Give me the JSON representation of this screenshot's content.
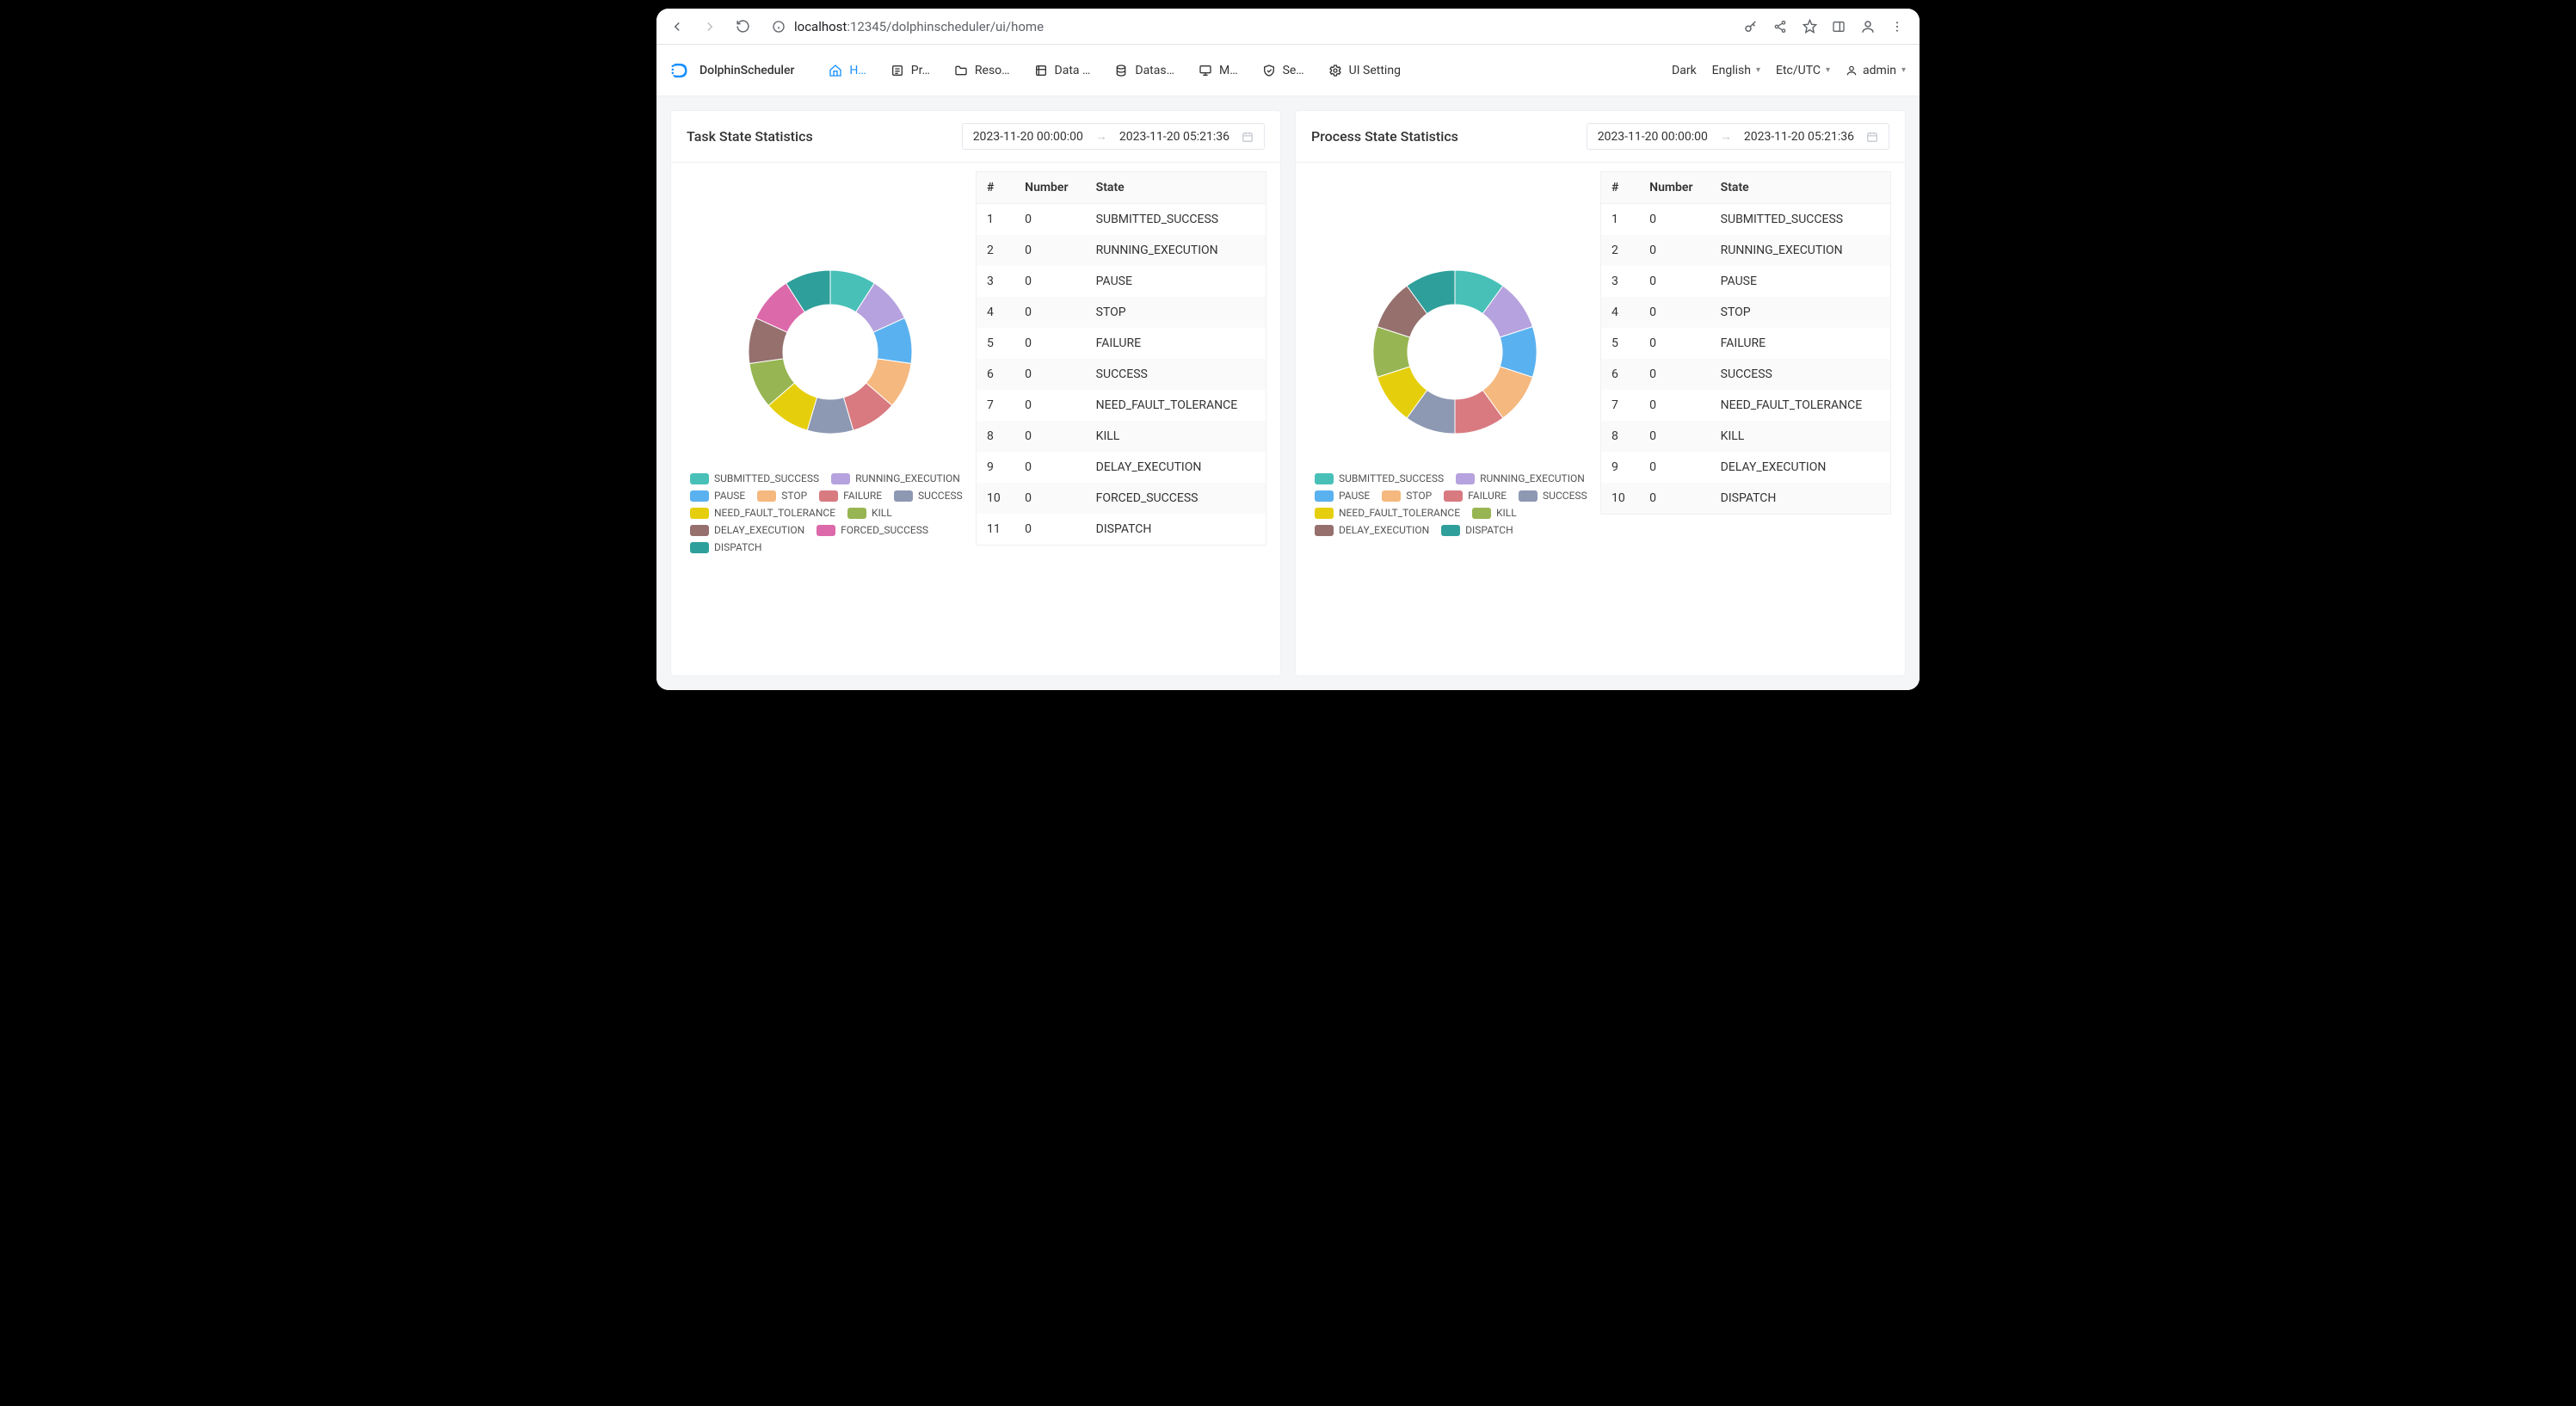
{
  "browser": {
    "url_host": "localhost",
    "url_port": ":12345",
    "url_path": "/dolphinscheduler/ui/home"
  },
  "header": {
    "product": "DolphinScheduler",
    "nav": [
      {
        "label": "H…",
        "icon": "home-icon",
        "active": true
      },
      {
        "label": "Pr…",
        "icon": "project-icon",
        "active": false
      },
      {
        "label": "Reso…",
        "icon": "folder-icon",
        "active": false
      },
      {
        "label": "Data …",
        "icon": "datacenter-icon",
        "active": false
      },
      {
        "label": "Datas…",
        "icon": "datasource-icon",
        "active": false
      },
      {
        "label": "M…",
        "icon": "monitor-icon",
        "active": false
      },
      {
        "label": "Se…",
        "icon": "security-icon",
        "active": false
      },
      {
        "label": "UI Setting",
        "icon": "gear-icon",
        "active": false
      }
    ],
    "theme": "Dark",
    "language": "English",
    "timezone": "Etc/UTC",
    "user": "admin"
  },
  "colors": {
    "SUBMITTED_SUCCESS": "#48c0b8",
    "RUNNING_EXECUTION": "#b6a2de",
    "PAUSE": "#5ab1ef",
    "STOP": "#f5b87f",
    "FAILURE": "#d87a80",
    "SUCCESS": "#8d98b3",
    "NEED_FAULT_TOLERANCE": "#e5cf0d",
    "KILL": "#97b552",
    "DELAY_EXECUTION": "#95706d",
    "FORCED_SUCCESS": "#dc69aa",
    "DISPATCH": "#2f9f9b"
  },
  "cards": [
    {
      "title": "Task State Statistics",
      "range_from": "2023-11-20 00:00:00",
      "range_to": "2023-11-20 05:21:36",
      "columns": [
        "#",
        "Number",
        "State"
      ],
      "rows": [
        {
          "idx": 1,
          "num": 0,
          "state": "SUBMITTED_SUCCESS"
        },
        {
          "idx": 2,
          "num": 0,
          "state": "RUNNING_EXECUTION"
        },
        {
          "idx": 3,
          "num": 0,
          "state": "PAUSE"
        },
        {
          "idx": 4,
          "num": 0,
          "state": "STOP"
        },
        {
          "idx": 5,
          "num": 0,
          "state": "FAILURE"
        },
        {
          "idx": 6,
          "num": 0,
          "state": "SUCCESS"
        },
        {
          "idx": 7,
          "num": 0,
          "state": "NEED_FAULT_TOLERANCE"
        },
        {
          "idx": 8,
          "num": 0,
          "state": "KILL"
        },
        {
          "idx": 9,
          "num": 0,
          "state": "DELAY_EXECUTION"
        },
        {
          "idx": 10,
          "num": 0,
          "state": "FORCED_SUCCESS"
        },
        {
          "idx": 11,
          "num": 0,
          "state": "DISPATCH"
        }
      ],
      "legend": [
        "SUBMITTED_SUCCESS",
        "RUNNING_EXECUTION",
        "PAUSE",
        "STOP",
        "FAILURE",
        "SUCCESS",
        "NEED_FAULT_TOLERANCE",
        "KILL",
        "DELAY_EXECUTION",
        "FORCED_SUCCESS",
        "DISPATCH"
      ]
    },
    {
      "title": "Process State Statistics",
      "range_from": "2023-11-20 00:00:00",
      "range_to": "2023-11-20 05:21:36",
      "columns": [
        "#",
        "Number",
        "State"
      ],
      "rows": [
        {
          "idx": 1,
          "num": 0,
          "state": "SUBMITTED_SUCCESS"
        },
        {
          "idx": 2,
          "num": 0,
          "state": "RUNNING_EXECUTION"
        },
        {
          "idx": 3,
          "num": 0,
          "state": "PAUSE"
        },
        {
          "idx": 4,
          "num": 0,
          "state": "STOP"
        },
        {
          "idx": 5,
          "num": 0,
          "state": "FAILURE"
        },
        {
          "idx": 6,
          "num": 0,
          "state": "SUCCESS"
        },
        {
          "idx": 7,
          "num": 0,
          "state": "NEED_FAULT_TOLERANCE"
        },
        {
          "idx": 8,
          "num": 0,
          "state": "KILL"
        },
        {
          "idx": 9,
          "num": 0,
          "state": "DELAY_EXECUTION"
        },
        {
          "idx": 10,
          "num": 0,
          "state": "DISPATCH"
        }
      ],
      "legend": [
        "SUBMITTED_SUCCESS",
        "RUNNING_EXECUTION",
        "PAUSE",
        "STOP",
        "FAILURE",
        "SUCCESS",
        "NEED_FAULT_TOLERANCE",
        "KILL",
        "DELAY_EXECUTION",
        "DISPATCH"
      ]
    }
  ],
  "chart_data": [
    {
      "type": "pie",
      "title": "Task State Statistics",
      "categories": [
        "SUBMITTED_SUCCESS",
        "RUNNING_EXECUTION",
        "PAUSE",
        "STOP",
        "FAILURE",
        "SUCCESS",
        "NEED_FAULT_TOLERANCE",
        "KILL",
        "DELAY_EXECUTION",
        "FORCED_SUCCESS",
        "DISPATCH"
      ],
      "values": [
        0,
        0,
        0,
        0,
        0,
        0,
        0,
        0,
        0,
        0,
        0
      ],
      "note": "all values are zero; chart renders equal-weight placeholder slices"
    },
    {
      "type": "pie",
      "title": "Process State Statistics",
      "categories": [
        "SUBMITTED_SUCCESS",
        "RUNNING_EXECUTION",
        "PAUSE",
        "STOP",
        "FAILURE",
        "SUCCESS",
        "NEED_FAULT_TOLERANCE",
        "KILL",
        "DELAY_EXECUTION",
        "DISPATCH"
      ],
      "values": [
        0,
        0,
        0,
        0,
        0,
        0,
        0,
        0,
        0,
        0
      ],
      "note": "all values are zero; chart renders equal-weight placeholder slices"
    }
  ]
}
